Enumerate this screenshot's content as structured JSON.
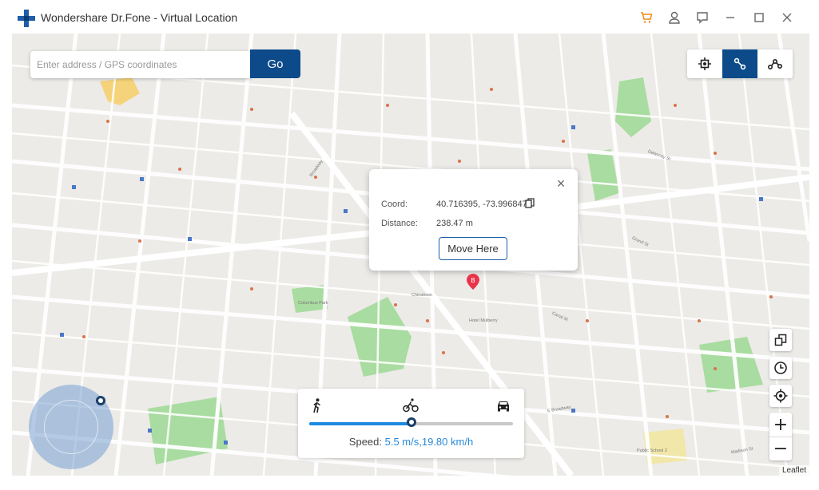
{
  "window": {
    "title": "Wondershare Dr.Fone - Virtual Location",
    "icons": [
      "cart-icon",
      "account-icon",
      "feedback-icon",
      "minimize-icon",
      "maximize-icon",
      "close-icon"
    ]
  },
  "search": {
    "placeholder": "Enter address / GPS coordinates",
    "value": "",
    "go_label": "Go"
  },
  "modes": [
    {
      "name": "teleport-mode",
      "icon": "teleport-icon",
      "active": false
    },
    {
      "name": "one-stop-route",
      "icon": "two-spot-route-icon",
      "active": true
    },
    {
      "name": "multi-stop-route",
      "icon": "multi-spot-route-icon",
      "active": false
    }
  ],
  "popup": {
    "coord_label": "Coord:",
    "coord_value": "40.716395, -73.996847",
    "distance_label": "Distance:",
    "distance_value": "238.47 m",
    "move_button": "Move Here"
  },
  "marker": {
    "label": "B"
  },
  "speed": {
    "label": "Speed:",
    "value": "5.5 m/s,19.80 km/h",
    "level": 0.5,
    "modes": [
      "walk-icon",
      "bike-icon",
      "car-icon"
    ]
  },
  "map_controls": [
    "map-type-icon",
    "history-icon",
    "locate-icon",
    "zoom-in",
    "zoom-out"
  ],
  "zoom": {
    "in": "+",
    "out": "−"
  },
  "attribution": "Leaflet",
  "map_labels": [
    {
      "text": "Broadway",
      "cls": "street"
    },
    {
      "text": "Canal St",
      "cls": "street"
    },
    {
      "text": "Grand St",
      "cls": "street"
    },
    {
      "text": "Delancey St",
      "cls": "street"
    },
    {
      "text": "Chinatown",
      "cls": "area"
    },
    {
      "text": "Columbus Park",
      "cls": "area"
    },
    {
      "text": "Hotel Mulberry",
      "cls": "poi"
    },
    {
      "text": "Public School 2",
      "cls": "poi"
    },
    {
      "text": "Madison St",
      "cls": "street"
    },
    {
      "text": "E Broadway",
      "cls": "street"
    }
  ],
  "colors": {
    "accent": "#0c4a8a",
    "slider": "#1f8ae0",
    "speed_text": "#2a8ad8",
    "marker": "#e8334a",
    "map_bg": "#ecebe8",
    "park": "#a9dca0"
  }
}
